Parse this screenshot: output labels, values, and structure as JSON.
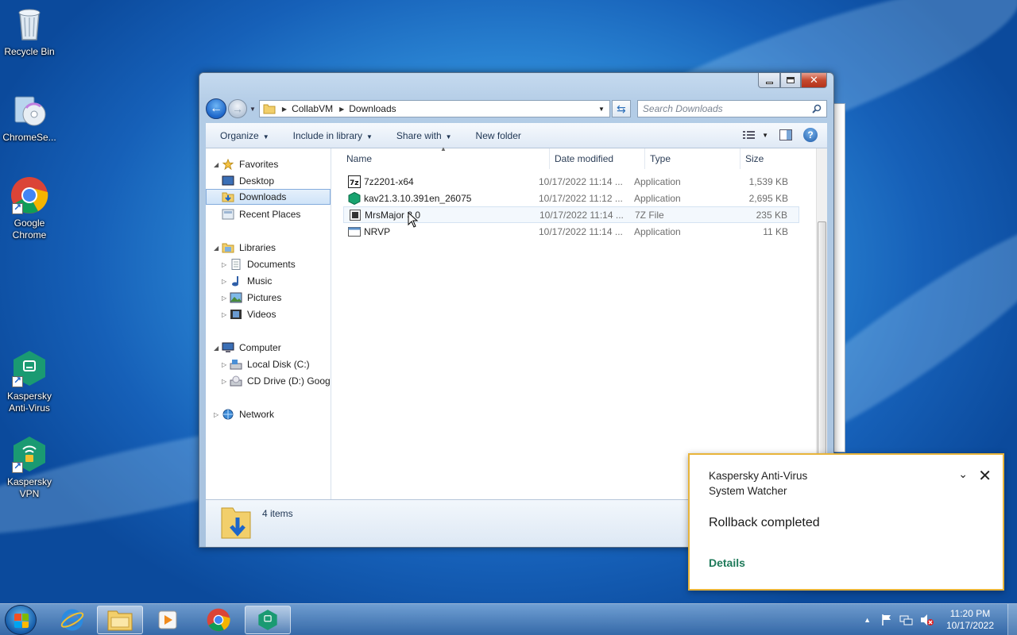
{
  "desktop": {
    "icons": [
      {
        "label": "Recycle Bin"
      },
      {
        "label": "ChromeSe..."
      },
      {
        "label": "Google Chrome"
      },
      {
        "label": "Kaspersky Anti-Virus"
      },
      {
        "label": "Kaspersky VPN"
      }
    ]
  },
  "explorer": {
    "breadcrumb": [
      "CollabVM",
      "Downloads"
    ],
    "search_placeholder": "Search Downloads",
    "toolbar": {
      "organize": "Organize",
      "include_in_library": "Include in library",
      "share_with": "Share with",
      "new_folder": "New folder"
    },
    "nav": {
      "favorites": "Favorites",
      "desktop": "Desktop",
      "downloads": "Downloads",
      "recent_places": "Recent Places",
      "libraries": "Libraries",
      "documents": "Documents",
      "music": "Music",
      "pictures": "Pictures",
      "videos": "Videos",
      "computer": "Computer",
      "local_disk": "Local Disk (C:)",
      "cd_drive": "CD Drive (D:) Google",
      "network": "Network"
    },
    "columns": {
      "name": "Name",
      "date": "Date modified",
      "type": "Type",
      "size": "Size"
    },
    "files": [
      {
        "name": "7z2201-x64",
        "date": "10/17/2022 11:14 ...",
        "type": "Application",
        "size": "1,539 KB"
      },
      {
        "name": "kav21.3.10.391en_26075",
        "date": "10/17/2022 11:12 ...",
        "type": "Application",
        "size": "2,695 KB"
      },
      {
        "name": "MrsMajor 3.0",
        "date": "10/17/2022 11:14 ...",
        "type": "7Z File",
        "size": "235 KB"
      },
      {
        "name": "NRVP",
        "date": "10/17/2022 11:14 ...",
        "type": "Application",
        "size": "11 KB"
      }
    ],
    "item_count": "4 items"
  },
  "notification": {
    "app": "Kaspersky Anti-Virus",
    "component": "System Watcher",
    "message": "Rollback completed",
    "details_link": "Details"
  },
  "taskbar": {
    "time": "11:20 PM",
    "date": "10/17/2022"
  },
  "colors": {
    "kaspersky_green": "#1f7a5a",
    "toast_border": "#e8b43a"
  }
}
